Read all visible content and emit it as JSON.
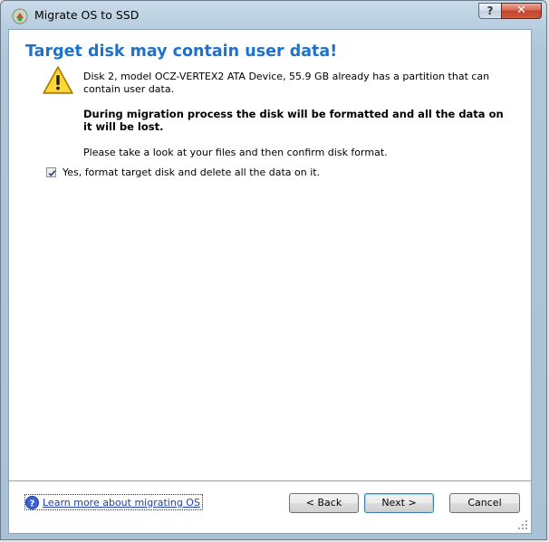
{
  "window": {
    "title": "Migrate OS to SSD",
    "help_label": "?",
    "close_label": "✕"
  },
  "page": {
    "heading": "Target disk may contain user data!",
    "message_line1": "Disk 2, model OCZ-VERTEX2 ATA Device, 55.9 GB already has a partition that can contain user data.",
    "message_warning": "During migration process the disk will be formatted and all the data on it will be lost.",
    "message_line3": "Please take a look at your files and then confirm disk format.",
    "checkbox": {
      "label": "Yes, format target disk and delete all the data on it.",
      "checked": true
    }
  },
  "footer": {
    "help_link": "Learn more about migrating OS",
    "back_label": "< Back",
    "next_label": "Next >",
    "cancel_label": "Cancel"
  },
  "colors": {
    "heading": "#1e72c9",
    "link": "#1f3ea8",
    "warning": "#f2c200"
  }
}
